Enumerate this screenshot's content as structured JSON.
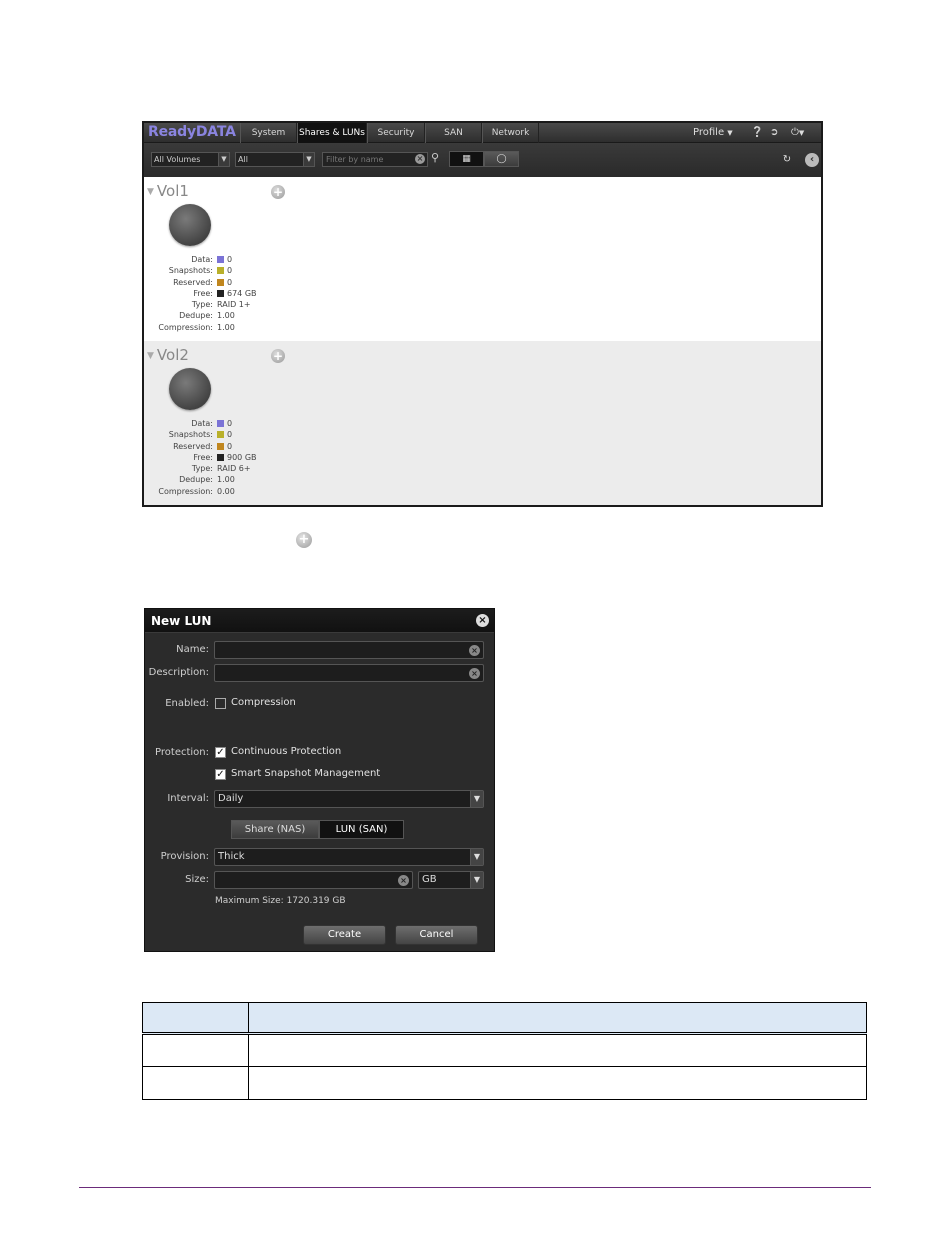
{
  "app": {
    "logo": "ReadyDATA",
    "nav_tabs": [
      "System",
      "Shares & LUNs",
      "Security",
      "SAN",
      "Network"
    ],
    "active_tab": "Shares & LUNs",
    "profile_label": "Profile",
    "toolbar": {
      "volume_filter": "All Volumes",
      "type_filter": "All",
      "name_filter_placeholder": "Filter by name"
    },
    "stat_labels": [
      "Data:",
      "Snapshots:",
      "Reserved:",
      "Free:",
      "Type:",
      "Dedupe:",
      "Compression:"
    ],
    "colors": {
      "data": "#7b73d6",
      "snapshots": "#b9b02a",
      "reserved": "#c0861e",
      "free": "#222222"
    },
    "volumes": [
      {
        "name": "Vol1",
        "data": "0",
        "snapshots": "0",
        "reserved": "0",
        "free": "674 GB",
        "type": "RAID 1+",
        "dedupe": "1.00",
        "compression": "1.00"
      },
      {
        "name": "Vol2",
        "data": "0",
        "snapshots": "0",
        "reserved": "0",
        "free": "900 GB",
        "type": "RAID 6+",
        "dedupe": "1.00",
        "compression": "0.00"
      }
    ]
  },
  "dialog": {
    "title": "New LUN",
    "name_label": "Name:",
    "description_label": "Description:",
    "enabled_label": "Enabled:",
    "compression_label": "Compression",
    "compression_checked": false,
    "protection_label": "Protection:",
    "continuous_protection_label": "Continuous Protection",
    "continuous_protection_checked": true,
    "smart_snapshot_label": "Smart Snapshot Management",
    "smart_snapshot_checked": true,
    "interval_label": "Interval:",
    "interval_value": "Daily",
    "segment_share": "Share (NAS)",
    "segment_lun": "LUN (SAN)",
    "active_segment": "LUN (SAN)",
    "provision_label": "Provision:",
    "provision_value": "Thick",
    "size_label": "Size:",
    "size_unit": "GB",
    "max_size": "Maximum Size: 1720.319 GB",
    "create_button": "Create",
    "cancel_button": "Cancel"
  }
}
